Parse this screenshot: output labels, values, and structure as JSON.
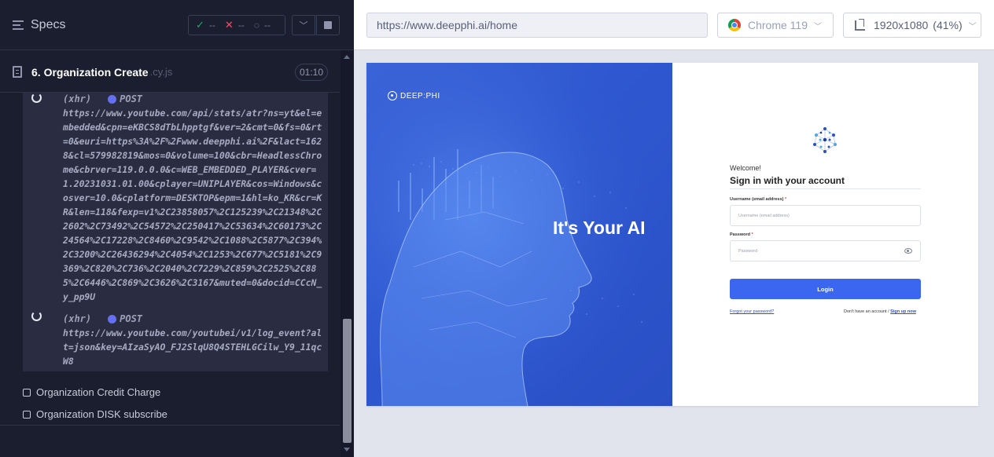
{
  "reporter": {
    "title": "Specs",
    "stats": {
      "passed": "--",
      "failed": "--",
      "pending": "--"
    },
    "spec": {
      "name": "6. Organization Create",
      "ext": ".cy.js",
      "duration": "01:10"
    },
    "logs": [
      {
        "type": "(xhr)",
        "method": "POST",
        "url": "https://www.youtube.com/api/stats/atr?ns=yt&el=embedded&cpn=eKBCS8dTbLhpptgf&ver=2&cmt=0&fs=0&rt=0&euri=https%3A%2F%2Fwww.deepphi.ai%2F&lact=1628&cl=579982819&mos=0&volume=100&cbr=HeadlessChrome&cbrver=119.0.0.0&c=WEB_EMBEDDED_PLAYER&cver=1.20231031.01.00&cplayer=UNIPLAYER&cos=Windows&cosver=10.0&cplatform=DESKTOP&epm=1&hl=ko_KR&cr=KR&len=118&fexp=v1%2C23858057%2C125239%2C21348%2C2602%2C73492%2C54572%2C250417%2C53634%2C60173%2C24564%2C17228%2C8460%2C9542%2C1088%2C5877%2C394%2C3200%2C26436294%2C4054%2C1253%2C677%2C5181%2C9369%2C820%2C736%2C2040%2C7229%2C859%2C2525%2C885%2C6446%2C869%2C3626%2C3167&muted=0&docid=CCcN_y_pp9U"
      },
      {
        "type": "(xhr)",
        "method": "POST",
        "url": "https://www.youtube.com/youtubei/v1/log_event?alt=json&key=AIzaSyAO_FJ2SlqU8Q4STEHLGCilw_Y9_11qcW8"
      }
    ],
    "tests": [
      "Organization Credit Charge",
      "Organization DISK subscribe"
    ]
  },
  "aut": {
    "url": "https://www.deepphi.ai/home",
    "browser": "Chrome 119",
    "viewport": "1920x1080",
    "zoom": "(41%)"
  },
  "app": {
    "logo_text": "DEEP:PHI",
    "hero_title": "It's Your AI",
    "welcome": "Welcome!",
    "signin_title": "Sign in with your account",
    "username_label": "Username (email address)",
    "username_placeholder": "Username (email address)",
    "password_label": "Password",
    "password_placeholder": "Password",
    "login_button": "Login",
    "forgot_link": "Forgot your password?",
    "no_account_text": "Don't have an account /",
    "signup_link": "Sign up now"
  },
  "colors": {
    "reporter_bg": "#1b1e2e",
    "log_bg": "#2a2d42",
    "hero_blue": "#2f58d0",
    "login_button": "#3b66f0",
    "xhr_dot": "#6470f3"
  }
}
